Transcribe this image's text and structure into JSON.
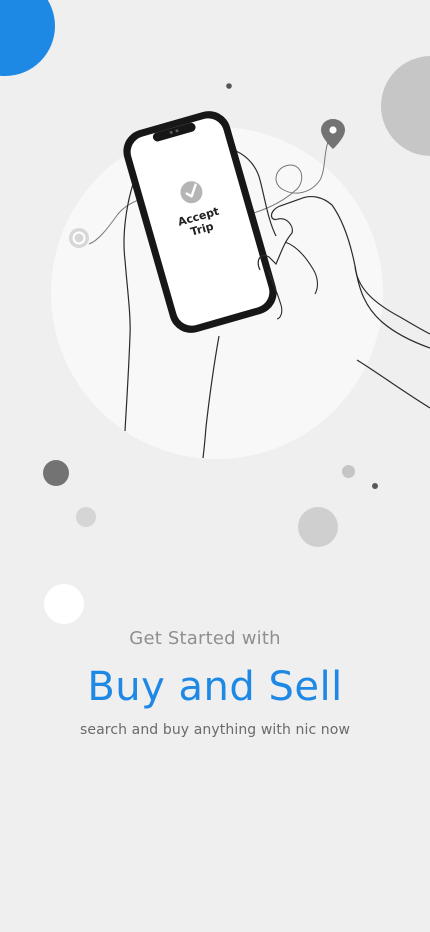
{
  "illustration": {
    "icon": "phone-in-hand-accept-trip",
    "phone_caption_line1": "Accept",
    "phone_caption_line2": "Trip"
  },
  "intro": {
    "eyebrow": "Get Started with",
    "headline": "Buy and Sell",
    "subtitle": "search and buy anything with nic now"
  },
  "colors": {
    "accent": "#1E88E5",
    "background": "#EFEFEF",
    "muted_text": "#8F8F8F"
  }
}
